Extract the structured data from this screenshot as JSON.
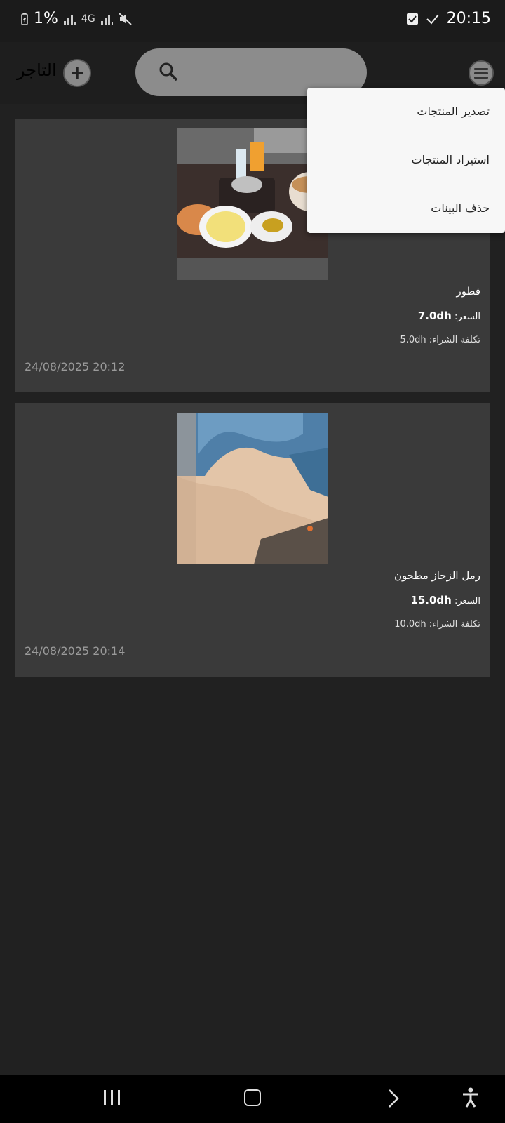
{
  "status_bar": {
    "battery_text": "1%",
    "network_text": "4G",
    "time": "20:15"
  },
  "app_bar": {
    "title": "التاجر",
    "search_placeholder": ""
  },
  "menu": {
    "items": [
      {
        "label": "تصدير المنتجات"
      },
      {
        "label": "استيراد المنتجات"
      },
      {
        "label": "حذف البينات"
      }
    ]
  },
  "products": [
    {
      "name": "فطور",
      "price_label": "السعر:",
      "price": "7.0dh",
      "cost_label": "تكلفة الشراء:",
      "cost": "5.0dh",
      "date": "24/08/2025 20:12"
    },
    {
      "name": "رمل الزجاز مطحون",
      "price_label": "السعر:",
      "price": "15.0dh",
      "cost_label": "تكلفة الشراء:",
      "cost": "10.0dh",
      "date": "24/08/2025 20:14"
    }
  ],
  "colors": {
    "background": "#212121",
    "card": "#3a3a3a",
    "menu_bg": "#f7f7f7"
  }
}
